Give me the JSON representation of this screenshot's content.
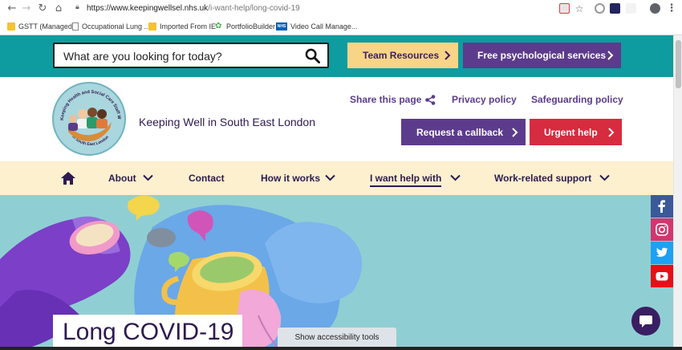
{
  "browser": {
    "url_host": "https://www.keepingwellsel.nhs.uk",
    "url_path": "/i-want-help/long-covid-19",
    "bookmarks": [
      {
        "label": "GSTT (Managed)",
        "icon": "folder-icon"
      },
      {
        "label": "Occupational Lung ...",
        "icon": "page-icon"
      },
      {
        "label": "Imported From IE",
        "icon": "folder-icon"
      },
      {
        "label": "PortfolioBuilder",
        "icon": "portfoliobuilder-icon"
      },
      {
        "label": "Video Call Manage...",
        "icon": "nhs-icon"
      }
    ],
    "nhs_badge": "NHS"
  },
  "topbar": {
    "search_placeholder": "What are you looking for today?",
    "team_resources": "Team Resources",
    "free_services": "Free psychological services"
  },
  "header": {
    "site_title": "Keeping Well in South East London",
    "logo_text_top": "Keeping Health and Social Care Staff Well",
    "logo_text_bottom": "in South East London",
    "share": "Share this page",
    "privacy": "Privacy policy",
    "safeguarding": "Safeguarding policy",
    "callback": "Request a callback",
    "urgent": "Urgent help"
  },
  "nav": {
    "about": "About",
    "contact": "Contact",
    "how_it_works": "How it works",
    "i_want_help": "I want help with",
    "work_support": "Work-related support"
  },
  "hero": {
    "title": "Long COVID-19",
    "accessibility": "Show accessibility tools"
  },
  "social": [
    "facebook-icon",
    "instagram-icon",
    "twitter-icon",
    "youtube-icon"
  ],
  "colors": {
    "teal": "#0e9ca0",
    "purple": "#5c3b8c",
    "yellow": "#f8d487",
    "red": "#d72b3f",
    "cream": "#fdf0cf",
    "hero_bg": "#8fcfd3",
    "navy": "#2d1a4f"
  }
}
